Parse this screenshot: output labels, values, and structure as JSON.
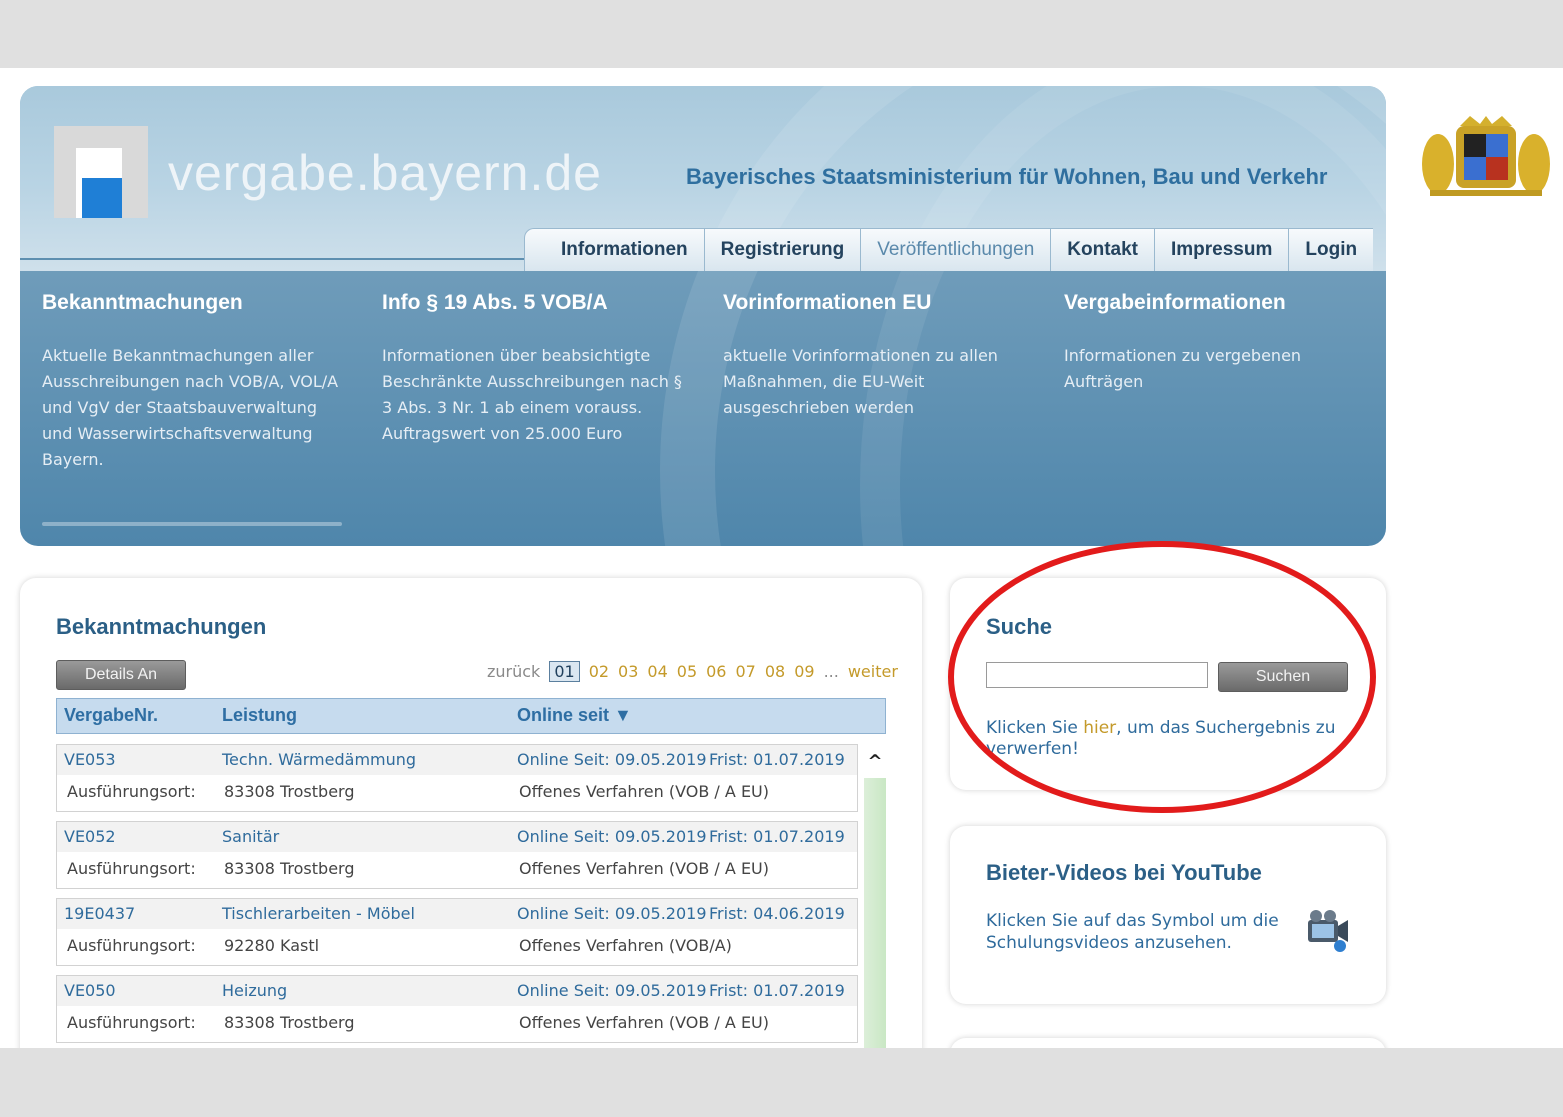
{
  "header": {
    "site_title": "vergabe.bayern.de",
    "ministry": "Bayerisches Staatsministerium für Wohnen, Bau und Verkehr",
    "nav": [
      "Informationen",
      "Registrierung",
      "Veröffentlichungen",
      "Kontakt",
      "Impressum",
      "Login"
    ],
    "active_nav": "Veröffentlichungen"
  },
  "banner_columns": [
    {
      "title": "Bekanntmachungen",
      "text": "Aktuelle Bekanntmachungen aller Ausschreibungen nach VOB/A, VOL/A und VgV der Staatsbauverwaltung und Wasserwirtschaftsverwaltung Bayern."
    },
    {
      "title": "Info § 19 Abs. 5 VOB/A",
      "text": "Informationen über beabsichtigte Beschränkte Ausschreibungen nach § 3 Abs. 3 Nr. 1 ab einem vorauss. Auftragswert von 25.000 Euro"
    },
    {
      "title": "Vorinformationen EU",
      "text": "aktuelle Vorinformationen zu allen Maßnahmen, die EU-Weit ausgeschrieben werden"
    },
    {
      "title": "Vergabeinformationen",
      "text": "Informationen zu vergebenen Aufträgen"
    }
  ],
  "crest_icon": "bavarian-coat-of-arms",
  "announcements": {
    "title": "Bekanntmachungen",
    "details_button": "Details An",
    "pager": {
      "back": "zurück",
      "pages": [
        "01",
        "02",
        "03",
        "04",
        "05",
        "06",
        "07",
        "08",
        "09"
      ],
      "current": "01",
      "ellipsis": "...",
      "next": "weiter"
    },
    "columns": {
      "nr": "VergabeNr.",
      "leistung": "Leistung",
      "online": "Online seit ▼"
    },
    "rows": [
      {
        "nr": "VE053",
        "leistung": "Techn. Wärmedämmung",
        "online": "Online Seit: 09.05.2019",
        "frist": "Frist: 01.07.2019",
        "ort_label": "Ausführungsort:",
        "ort": "83308 Trostberg",
        "verfahren": "Offenes Verfahren (VOB / A EU)"
      },
      {
        "nr": "VE052",
        "leistung": "Sanitär",
        "online": "Online Seit: 09.05.2019",
        "frist": "Frist: 01.07.2019",
        "ort_label": "Ausführungsort:",
        "ort": "83308 Trostberg",
        "verfahren": "Offenes Verfahren (VOB / A EU)"
      },
      {
        "nr": "19E0437",
        "leistung": "Tischlerarbeiten - Möbel",
        "online": "Online Seit: 09.05.2019",
        "frist": "Frist: 04.06.2019",
        "ort_label": "Ausführungsort:",
        "ort": "92280 Kastl",
        "verfahren": "Offenes Verfahren (VOB/A)"
      },
      {
        "nr": "VE050",
        "leistung": "Heizung",
        "online": "Online Seit: 09.05.2019",
        "frist": "Frist: 01.07.2019",
        "ort_label": "Ausführungsort:",
        "ort": "83308 Trostberg",
        "verfahren": "Offenes Verfahren (VOB / A EU)"
      }
    ]
  },
  "search": {
    "title": "Suche",
    "input_value": "",
    "button": "Suchen",
    "hint_before": "Klicken Sie ",
    "hint_link": "hier",
    "hint_after": ", um das Suchergebnis zu verwerfen!"
  },
  "videos": {
    "title": "Bieter-Videos bei YouTube",
    "text": "Klicken Sie auf das Symbol um die Schulungsvideos anzusehen.",
    "icon": "video-camera-icon"
  },
  "colors": {
    "accent_blue": "#2f6b9c",
    "link_gold": "#c49a2a",
    "highlight_red": "#e21b1b"
  }
}
